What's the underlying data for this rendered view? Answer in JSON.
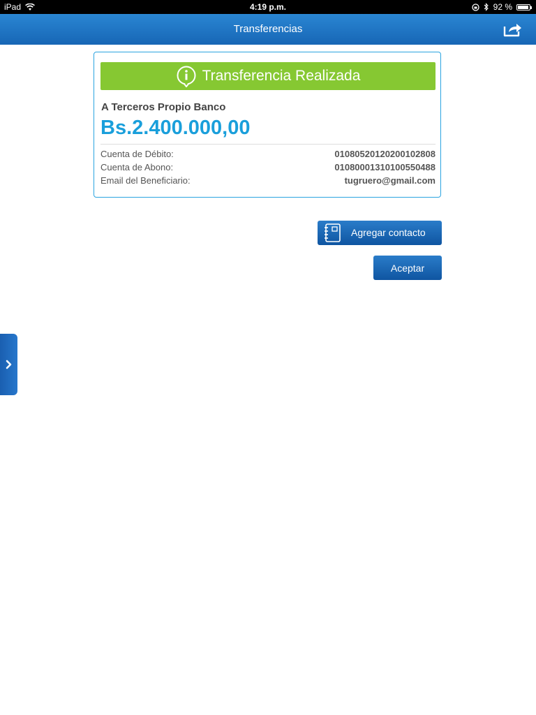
{
  "status_bar": {
    "device": "iPad",
    "time": "4:19 p.m.",
    "battery": "92 %",
    "battery_level": 0.92
  },
  "nav": {
    "title": "Transferencias",
    "share_icon": "share-icon"
  },
  "receipt": {
    "banner_text": "Transferencia Realizada",
    "banner_icon": "info-icon",
    "banner_color": "#86c832",
    "transfer_type": "A Terceros Propio Banco",
    "amount": "Bs.2.400.000,00",
    "amount_color": "#1a9fdb",
    "details": [
      {
        "label": "Cuenta de Débito:",
        "value": "01080520120200102808"
      },
      {
        "label": "Cuenta de Abono:",
        "value": "01080001310100550488"
      },
      {
        "label": "Email del Beneficiario:",
        "value": "tugruero@gmail.com"
      }
    ]
  },
  "actions": {
    "add_contact_label": "Agregar contacto",
    "add_contact_icon": "address-book-icon",
    "accept_label": "Aceptar"
  },
  "side_tab": {
    "icon": "chevron-right-icon"
  },
  "colors": {
    "primary": "#1766b5",
    "accent": "#2aa3e0"
  }
}
